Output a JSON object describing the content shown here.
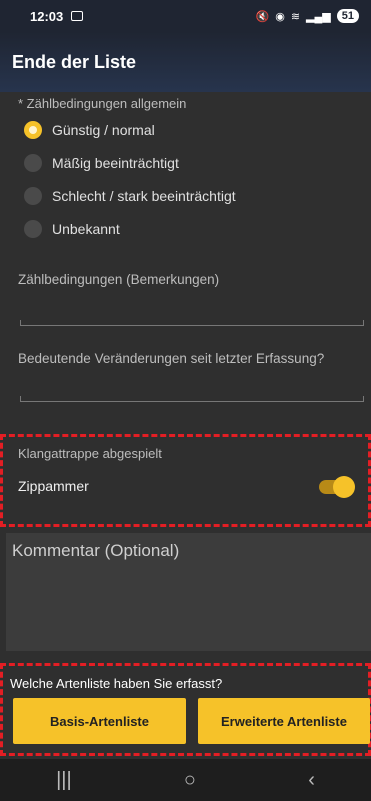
{
  "status": {
    "time": "12:03",
    "battery": "51"
  },
  "appbar": {
    "title": "Ende der Liste"
  },
  "counting": {
    "label": "* Zählbedingungen allgemein",
    "options": [
      {
        "label": "Günstig / normal",
        "selected": true
      },
      {
        "label": "Mäßig beeinträchtigt",
        "selected": false
      },
      {
        "label": "Schlecht / stark beeinträchtigt",
        "selected": false
      },
      {
        "label": "Unbekannt",
        "selected": false
      }
    ]
  },
  "remarks": {
    "placeholder": "Zählbedingungen (Bemerkungen)",
    "value": ""
  },
  "changes": {
    "placeholder": "Bedeutende Veränderungen seit letzter Erfassung?",
    "value": ""
  },
  "playback": {
    "label": "Klangattrappe abgespielt",
    "species": "Zippammer",
    "toggle_on": true
  },
  "comment": {
    "placeholder": "Kommentar (Optional)",
    "value": ""
  },
  "list_question": {
    "prompt": "Welche Artenliste haben Sie erfasst?",
    "basic_button": "Basis-Artenliste",
    "extended_button": "Erweiterte Artenliste"
  },
  "nav": {
    "recent": "|||",
    "home": "○",
    "back": "‹"
  },
  "colors": {
    "accent": "#f6c229",
    "highlight_box": "#e31e24",
    "background": "#2f2f2f"
  }
}
